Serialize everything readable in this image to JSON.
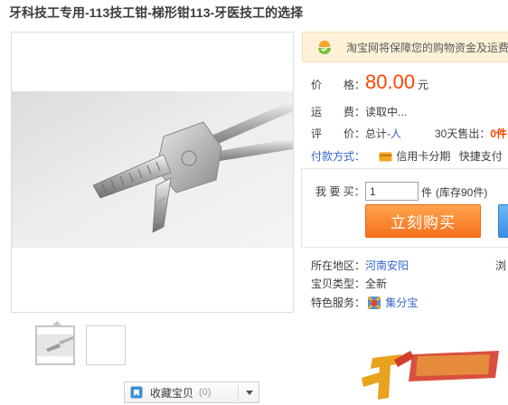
{
  "page": {
    "title": "牙科技工专用-113技工钳-梯形钳113-牙医技工的选择"
  },
  "gallery": {
    "thumb_count": 2
  },
  "favorite": {
    "label": "收藏宝贝",
    "count": "(0)"
  },
  "notice": {
    "text": "淘宝网将保障您的购物资金及运费"
  },
  "price": {
    "label": "价　　格：",
    "value": "80.00",
    "unit": "元"
  },
  "shipping": {
    "label": "运　　费：",
    "value": "读取中..."
  },
  "review": {
    "label": "评　　价：",
    "total_prefix": "总计-",
    "total_count": "人",
    "sold_prefix": "30天售出：",
    "sold_count": "0件"
  },
  "payment": {
    "label": "付款方式：",
    "credit": "信用卡分期",
    "quick": "快捷支付"
  },
  "purchase": {
    "qty_label": "我 要 买：",
    "qty_value": "1",
    "qty_unit": "件",
    "stock": "(库存90件)",
    "buy_label": "立刻购买"
  },
  "details": {
    "location_label": "所在地区：",
    "location_value": "河南安阳",
    "browse": "浏",
    "type_label": "宝贝类型：",
    "type_value": "全新",
    "service_label": "特色服务：",
    "service_value": "集分宝"
  },
  "colors": {
    "price": "#ff4400",
    "link": "#3366cc",
    "buy_button": "#f6701c",
    "notice_bg": "#fdf1d8"
  }
}
